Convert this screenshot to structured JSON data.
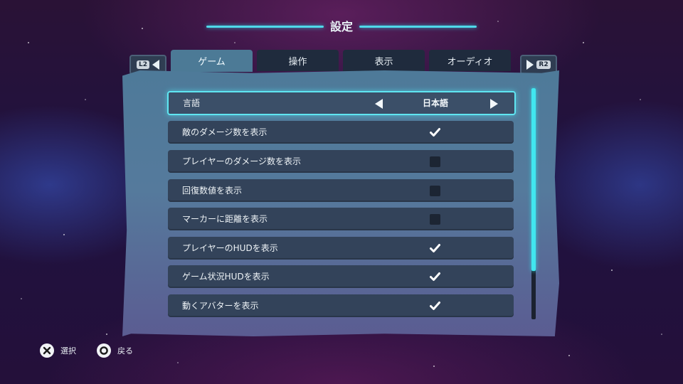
{
  "title": "設定",
  "bumpers": {
    "left": "L2",
    "right": "R2"
  },
  "tabs": [
    {
      "label": "ゲーム",
      "active": true
    },
    {
      "label": "操作",
      "active": false
    },
    {
      "label": "表示",
      "active": false
    },
    {
      "label": "オーディオ",
      "active": false
    }
  ],
  "settings": {
    "language": {
      "label": "言語",
      "value": "日本語"
    },
    "toggles": [
      {
        "label": "敵のダメージ数を表示",
        "checked": true
      },
      {
        "label": "プレイヤーのダメージ数を表示",
        "checked": false
      },
      {
        "label": "回復数値を表示",
        "checked": false
      },
      {
        "label": "マーカーに距離を表示",
        "checked": false
      },
      {
        "label": "プレイヤーのHUDを表示",
        "checked": true
      },
      {
        "label": "ゲーム状況HUDを表示",
        "checked": true
      },
      {
        "label": "動くアバターを表示",
        "checked": true
      }
    ]
  },
  "scroll": {
    "visible_fraction": 0.79
  },
  "footer": {
    "select_label": "選択",
    "back_label": "戻る"
  },
  "colors": {
    "accent": "#41e6ef",
    "row": "#33435a",
    "active_tab": "#4c7a96"
  }
}
